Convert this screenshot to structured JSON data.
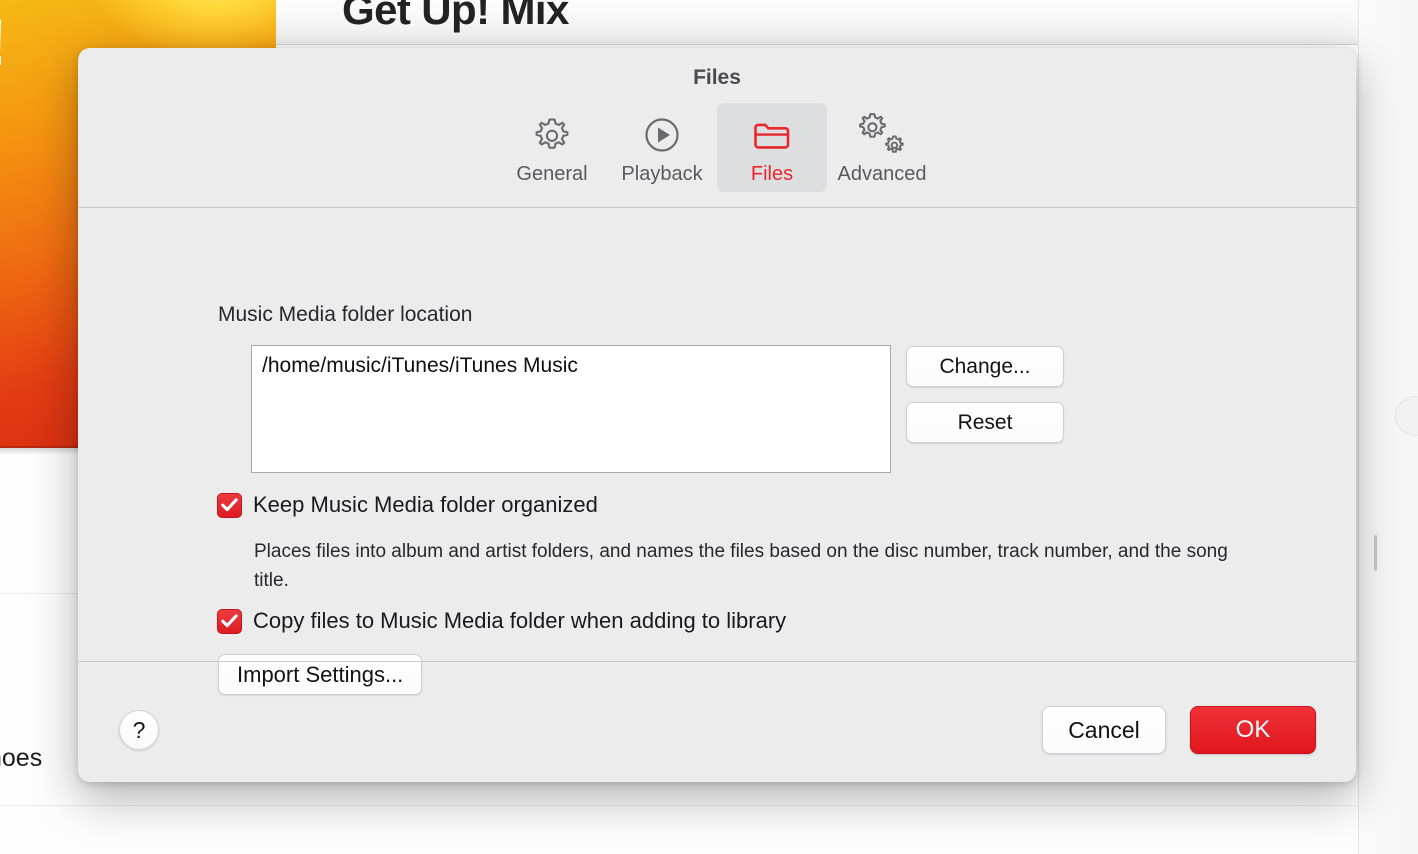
{
  "background": {
    "album_art_title": "p!",
    "playlist_title": "Get Up! Mix",
    "track_name_partial": "noes"
  },
  "dialog": {
    "title": "Files",
    "tabs": [
      {
        "label": "General",
        "icon": "gear-icon",
        "selected": false
      },
      {
        "label": "Playback",
        "icon": "play-circle-icon",
        "selected": false
      },
      {
        "label": "Files",
        "icon": "folder-icon",
        "selected": true
      },
      {
        "label": "Advanced",
        "icon": "double-gear-icon",
        "selected": false
      }
    ],
    "body": {
      "media_folder_label": "Music Media folder location",
      "media_folder_path": "/home/music/iTunes/iTunes Music",
      "change_button": "Change...",
      "reset_button": "Reset",
      "checkbox_organized": {
        "label": "Keep Music Media folder organized",
        "checked": true,
        "description": "Places files into album and artist folders, and names the files based on the disc number, track number, and the song title."
      },
      "checkbox_copy": {
        "label": "Copy files to Music Media folder when adding to library",
        "checked": true
      },
      "import_settings_button": "Import Settings..."
    },
    "footer": {
      "help_label": "?",
      "cancel_button": "Cancel",
      "ok_button": "OK"
    }
  },
  "colors": {
    "accent_red": "#e8272d",
    "ok_button_red": "#e1161d",
    "dialog_background": "#ececed",
    "album_gradient_start": "#f5b915",
    "album_gradient_end": "#d42a10"
  }
}
